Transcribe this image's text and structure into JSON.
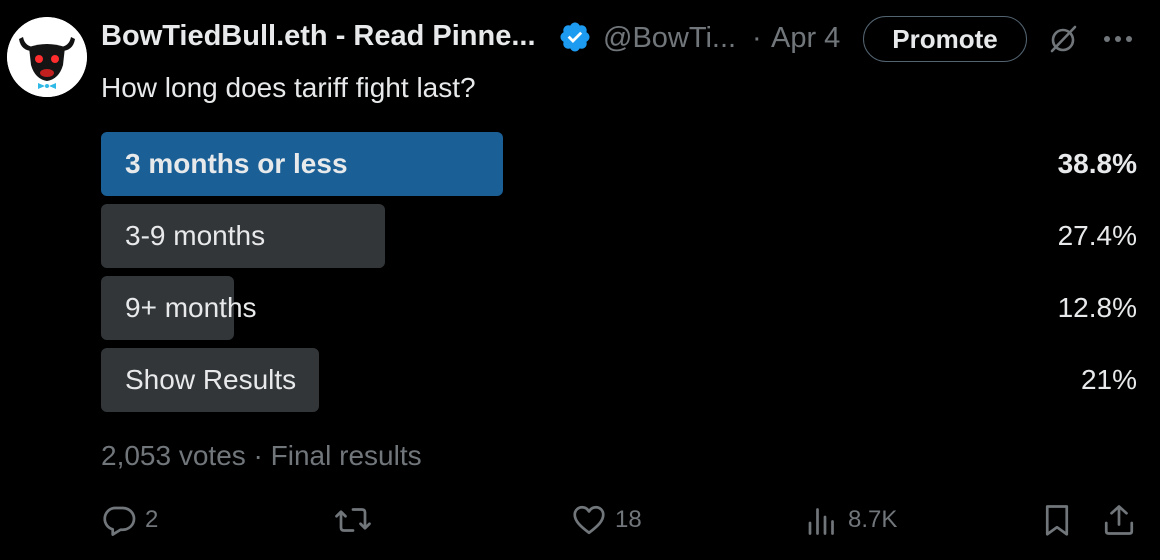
{
  "post": {
    "author": {
      "display_name": "BowTiedBull.eth - Read Pinne...",
      "verified_icon": "verified-badge-icon",
      "handle": "@BowTi...",
      "avatar_icon": "bull-head-avatar"
    },
    "separator": "·",
    "date": "Apr 4",
    "promote_label": "Promote",
    "text": "How long does tariff fight last?",
    "poll": {
      "options": [
        {
          "label": "3 months or less",
          "percent_text": "38.8%",
          "percent": 38.8,
          "winner": true
        },
        {
          "label": "3-9 months",
          "percent_text": "27.4%",
          "percent": 27.4,
          "winner": false
        },
        {
          "label": "9+ months",
          "percent_text": "12.8%",
          "percent": 12.8,
          "winner": false
        },
        {
          "label": "Show Results",
          "percent_text": "21%",
          "percent": 21,
          "winner": false
        }
      ],
      "meta": "2,053 votes · Final results"
    },
    "actions": {
      "replies": "2",
      "reposts": "",
      "likes": "18",
      "views": "8.7K"
    }
  },
  "colors": {
    "background": "#000000",
    "text_primary": "#e7e9ea",
    "text_secondary": "#71767b",
    "poll_winner": "#1a5f96",
    "poll_other": "#333639",
    "verified": "#1d9bf0"
  }
}
